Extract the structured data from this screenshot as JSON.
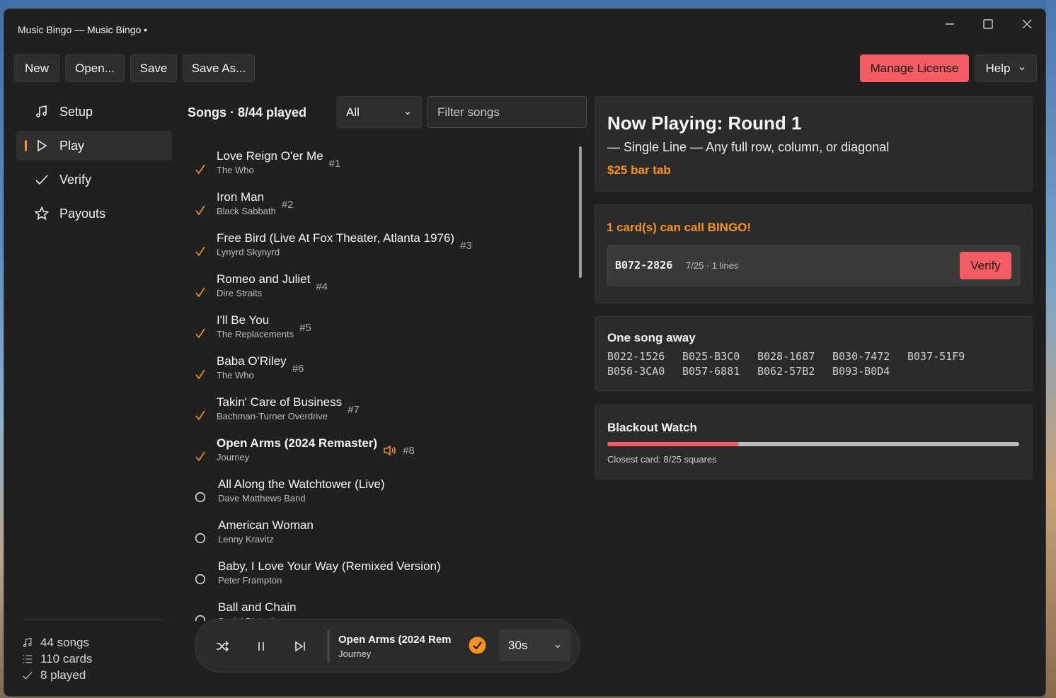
{
  "window": {
    "title": "Music Bingo — Music Bingo •"
  },
  "toolbar": {
    "new_label": "New",
    "open_label": "Open...",
    "save_label": "Save",
    "save_as_label": "Save As...",
    "license_label": "Manage License",
    "help_label": "Help"
  },
  "nav": {
    "items": [
      {
        "label": "Setup",
        "icon": "music-note-icon"
      },
      {
        "label": "Play",
        "icon": "play-icon",
        "active": true
      },
      {
        "label": "Verify",
        "icon": "checkmark-icon"
      },
      {
        "label": "Payouts",
        "icon": "star-icon"
      }
    ],
    "stats": {
      "songs": "44 songs",
      "cards": "110 cards",
      "played": "8 played"
    }
  },
  "songs": {
    "header": "Songs · 8/44 played",
    "filter_selected": "All",
    "filter_placeholder": "Filter songs",
    "list": [
      {
        "name": "Love Reign O'er Me",
        "artist": "The Who",
        "num": "#1",
        "played": true
      },
      {
        "name": "Iron Man",
        "artist": "Black Sabbath",
        "num": "#2",
        "played": true
      },
      {
        "name": "Free Bird (Live At Fox Theater, Atlanta 1976)",
        "artist": "Lynyrd Skynyrd",
        "num": "#3",
        "played": true
      },
      {
        "name": "Romeo and Juliet",
        "artist": "Dire Straits",
        "num": "#4",
        "played": true
      },
      {
        "name": "I'll Be You",
        "artist": "The Replacements",
        "num": "#5",
        "played": true
      },
      {
        "name": "Baba O'Riley",
        "artist": "The Who",
        "num": "#6",
        "played": true
      },
      {
        "name": "Takin' Care of Business",
        "artist": "Bachman-Turner Overdrive",
        "num": "#7",
        "played": true
      },
      {
        "name": "Open Arms (2024 Remaster)",
        "artist": "Journey",
        "num": "#8",
        "played": true,
        "current": true
      },
      {
        "name": "All Along the Watchtower (Live)",
        "artist": "Dave Matthews Band",
        "num": "",
        "played": false
      },
      {
        "name": "American Woman",
        "artist": "Lenny Kravitz",
        "num": "",
        "played": false
      },
      {
        "name": "Baby, I Love Your Way (Remixed Version)",
        "artist": "Peter Frampton",
        "num": "",
        "played": false
      },
      {
        "name": "Ball and Chain",
        "artist": "Social Distortion",
        "num": "",
        "played": false
      }
    ]
  },
  "player": {
    "title": "Open Arms (2024 Rem",
    "artist": "Journey",
    "duration": "30s"
  },
  "now_playing": {
    "title": "Now Playing: Round 1",
    "pattern": "— Single Line — Any full row, column, or diagonal",
    "prize": "$25 bar tab"
  },
  "bingo": {
    "title": "1 card(s) can call BINGO!",
    "card_id": "B072-2826",
    "card_meta": "7/25 · 1 lines",
    "verify_label": "Verify"
  },
  "one_away": {
    "title": "One song away",
    "cards": [
      "B022-1526",
      "B025-B3C0",
      "B028-1687",
      "B030-7472",
      "B037-51F9",
      "B056-3CA0",
      "B057-6881",
      "B062-57B2",
      "B093-B0D4"
    ]
  },
  "blackout": {
    "title": "Blackout Watch",
    "progress": 0.32,
    "note": "Closest card: 8/25 squares"
  },
  "colors": {
    "accent": "#f7931e",
    "danger": "#f25c62",
    "surface": "#2b2b2b",
    "background": "#202020"
  }
}
